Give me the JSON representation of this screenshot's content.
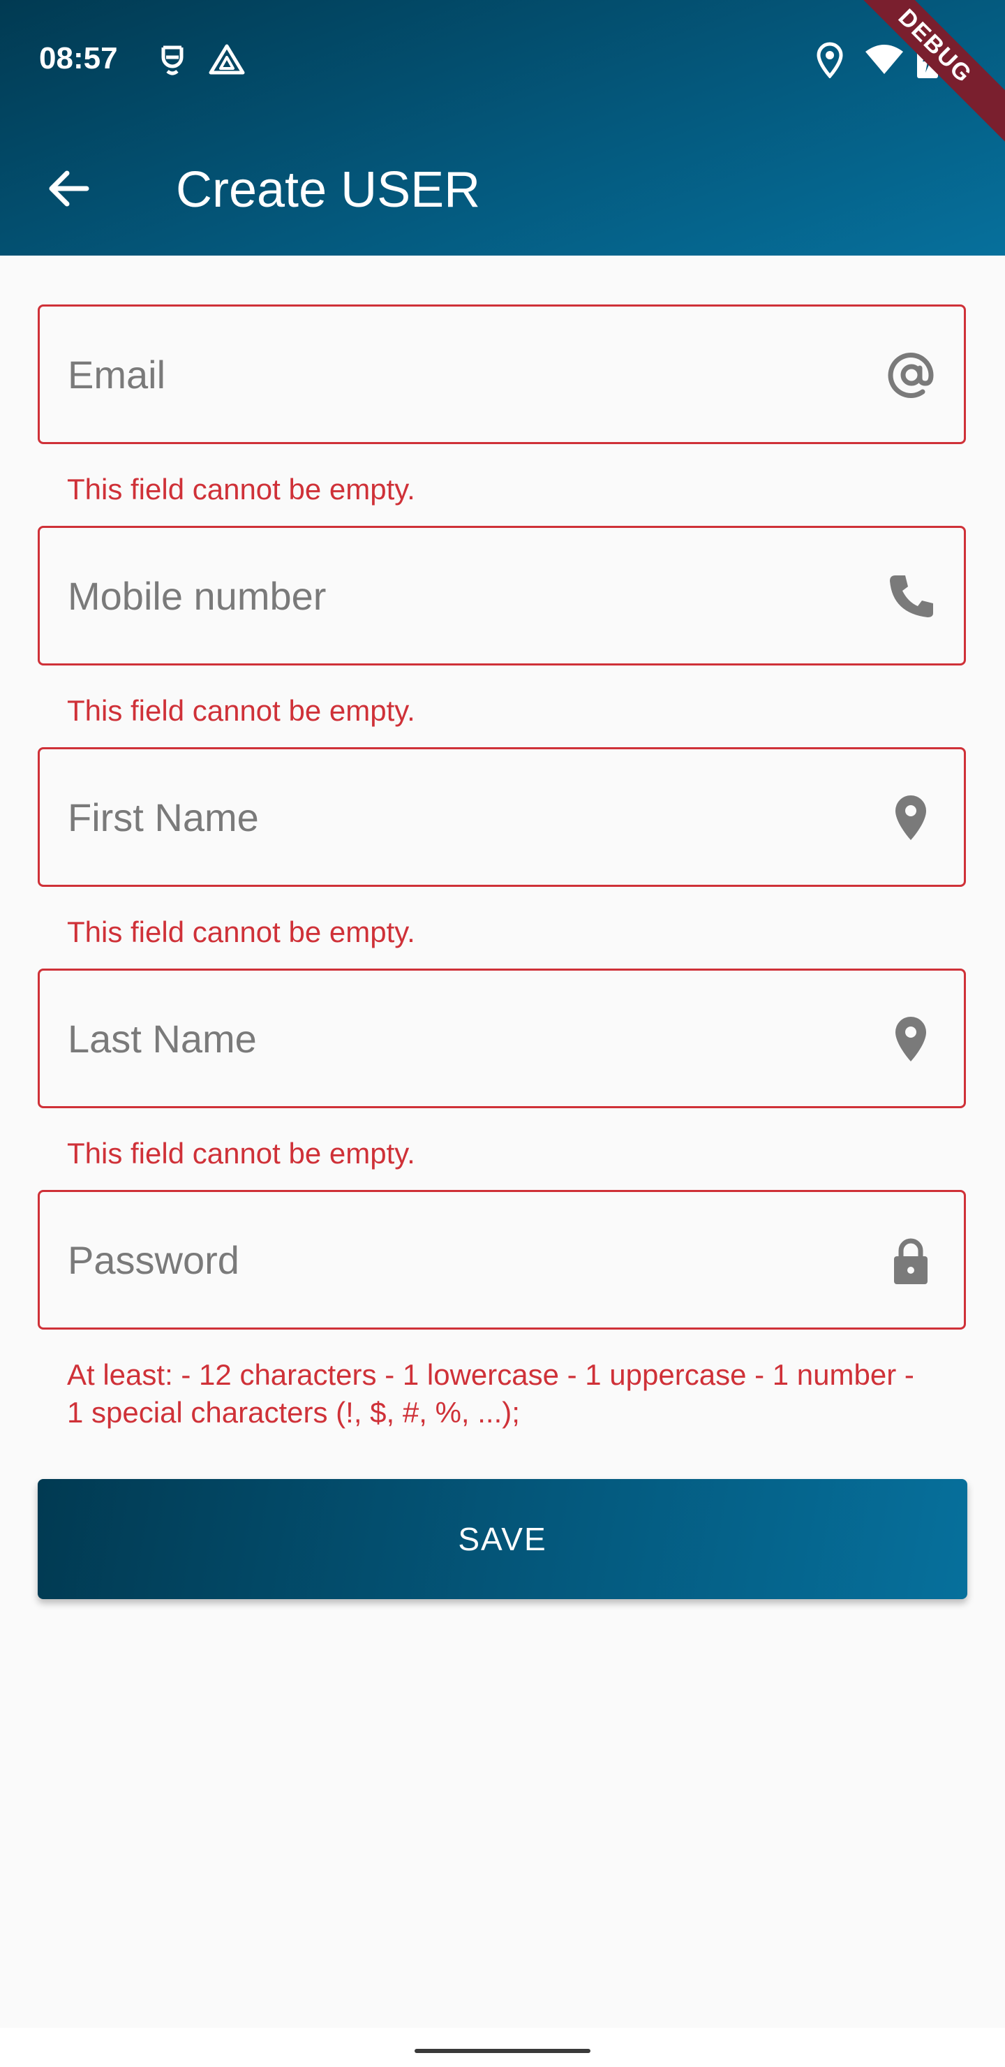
{
  "status_bar": {
    "time": "08:57",
    "icons": [
      "notification-shield-icon",
      "drive-icon",
      "location-icon",
      "wifi-icon",
      "battery-charging-icon"
    ],
    "debug_banner": "DEBUG"
  },
  "app_bar": {
    "back_icon": "arrow-back-icon",
    "title": "Create USER"
  },
  "form": {
    "email": {
      "placeholder": "Email",
      "value": "",
      "icon": "at-sign-icon",
      "error": "This field cannot be empty."
    },
    "mobile": {
      "placeholder": "Mobile number",
      "value": "",
      "icon": "phone-icon",
      "error": "This field cannot be empty."
    },
    "first_name": {
      "placeholder": "First Name",
      "value": "",
      "icon": "location-pin-icon",
      "error": "This field cannot be empty."
    },
    "last_name": {
      "placeholder": "Last Name",
      "value": "",
      "icon": "location-pin-icon",
      "error": "This field cannot be empty."
    },
    "password": {
      "placeholder": "Password",
      "value": "",
      "icon": "lock-icon",
      "error": "At least: - 12 characters - 1 lowercase - 1 uppercase - 1 number - 1 special characters (!, $, #, %, ...);"
    },
    "save_label": "SAVE"
  },
  "colors": {
    "primary_dark": "#013a52",
    "primary": "#06709c",
    "error": "#cf3138",
    "background": "#fafafa",
    "placeholder": "#7a7a7a"
  }
}
